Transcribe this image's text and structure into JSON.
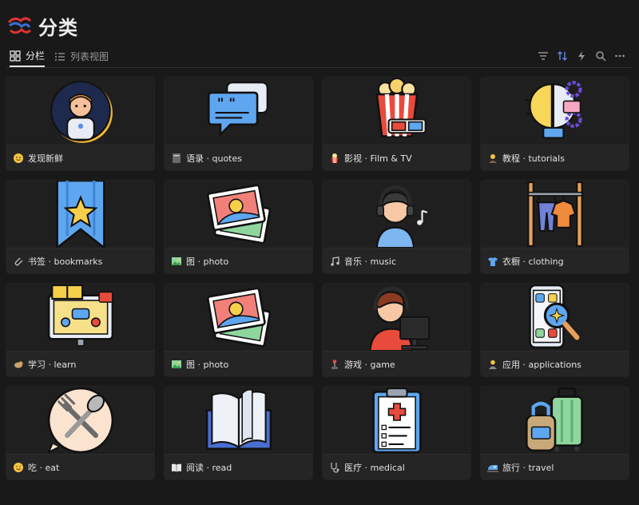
{
  "page": {
    "title": "分类"
  },
  "tabs": [
    {
      "label": "分栏",
      "active": true
    },
    {
      "label": "列表视图",
      "active": false
    }
  ],
  "toolbar": [
    "filter-icon",
    "sort-icon",
    "lightning-icon",
    "search-icon",
    "more-icon"
  ],
  "accent": "#5b8ee6",
  "cards": [
    {
      "label": "发现新鲜",
      "icon": "astronaut-icon"
    },
    {
      "label": "语录 · quotes",
      "icon": "chat-bubbles-icon"
    },
    {
      "label": "影视 · Film & TV",
      "icon": "popcorn-icon"
    },
    {
      "label": "教程 · tutorials",
      "icon": "lightbulb-gears-icon"
    },
    {
      "label": "书签 · bookmarks",
      "icon": "bookmark-star-icon"
    },
    {
      "label": "图 · photo",
      "icon": "photos-icon"
    },
    {
      "label": "音乐 · music",
      "icon": "headphones-girl-icon"
    },
    {
      "label": "衣橱 · clothing",
      "icon": "clothes-rack-icon"
    },
    {
      "label": "学习 · learn",
      "icon": "online-class-icon"
    },
    {
      "label": "图 · photo",
      "icon": "photos-icon"
    },
    {
      "label": "游戏 · game",
      "icon": "gamer-icon"
    },
    {
      "label": "应用 · applications",
      "icon": "phone-apps-icon"
    },
    {
      "label": "吃 · eat",
      "icon": "fork-spoon-icon"
    },
    {
      "label": "阅读 · read",
      "icon": "open-book-icon"
    },
    {
      "label": "医疗 · medical",
      "icon": "clipboard-medical-icon"
    },
    {
      "label": "旅行 · travel",
      "icon": "luggage-icon"
    }
  ]
}
